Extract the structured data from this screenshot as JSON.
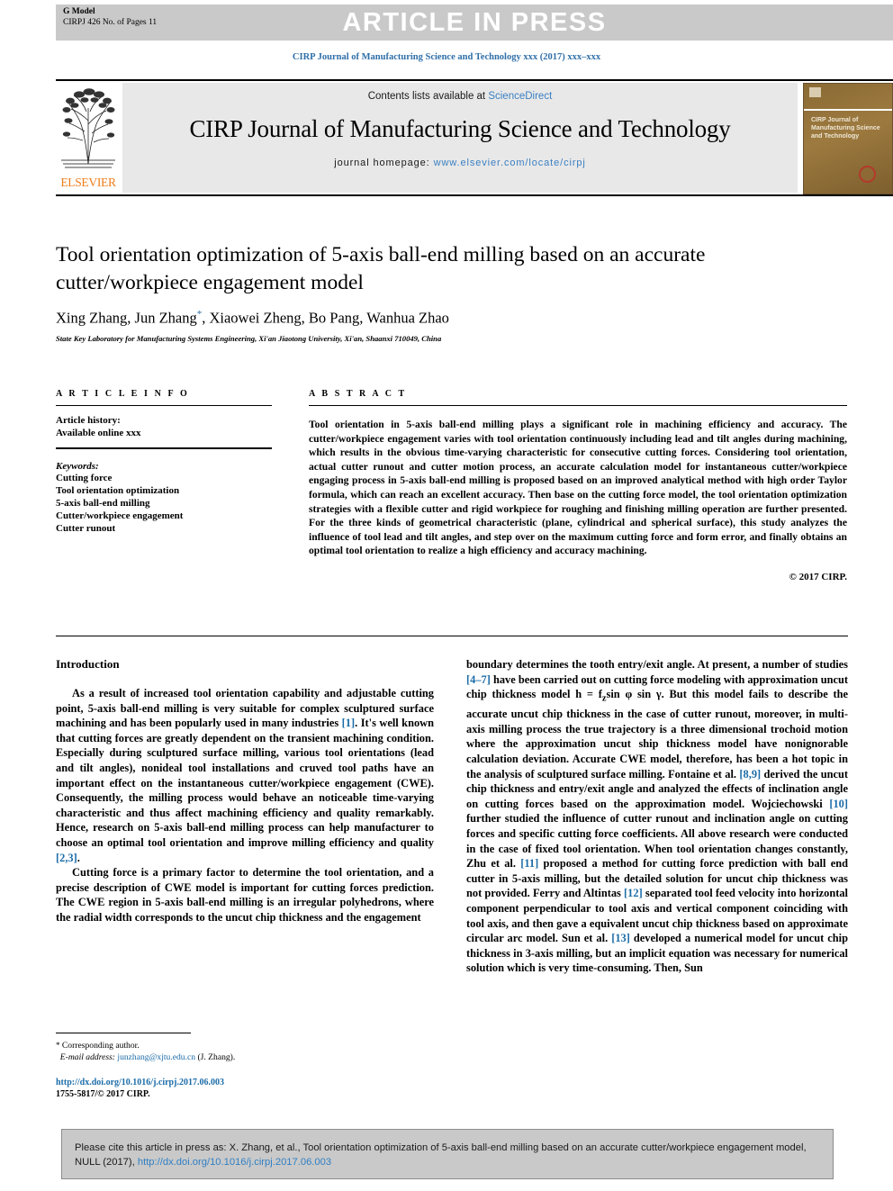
{
  "banner": {
    "gmodel_label": "G Model",
    "gmodel_sub": "CIRPJ 426 No. of Pages 11",
    "article_in_press": "ARTICLE IN PRESS"
  },
  "journal_ref": "CIRP Journal of Manufacturing Science and Technology xxx (2017) xxx–xxx",
  "masthead": {
    "publisher": "ELSEVIER",
    "contents_prefix": "Contents lists available at ",
    "contents_link": "ScienceDirect",
    "journal_title": "CIRP Journal of Manufacturing Science and Technology",
    "homepage_label": "journal homepage: ",
    "homepage_url": "www.elsevier.com/locate/cirpj",
    "cover_title": "CIRP Journal of Manufacturing Science and Technology"
  },
  "article": {
    "title": "Tool orientation optimization of 5-axis ball-end milling based on an accurate cutter/workpiece engagement model",
    "authors": "Xing Zhang, Jun Zhang",
    "authors_marker": "*",
    "authors_rest": ", Xiaowei Zheng, Bo Pang, Wanhua Zhao",
    "affiliation": "State Key Laboratory for Manufacturing Systems Engineering, Xi'an Jiaotong University, Xi'an, Shaanxi 710049, China"
  },
  "info": {
    "heading": "A R T I C L E   I N F O",
    "history_label": "Article history:",
    "history_value": "Available online xxx",
    "keywords_label": "Keywords:",
    "keywords": [
      "Cutting force",
      "Tool orientation optimization",
      "5-axis ball-end milling",
      "Cutter/workpiece engagement",
      "Cutter runout"
    ]
  },
  "abstract": {
    "heading": "A B S T R A C T",
    "text": "Tool orientation in 5-axis ball-end milling plays a significant role in machining efficiency and accuracy. The cutter/workpiece engagement varies with tool orientation continuously including lead and tilt angles during machining, which results in the obvious time-varying characteristic for consecutive cutting forces. Considering tool orientation, actual cutter runout and cutter motion process, an accurate calculation model for instantaneous cutter/workpiece engaging process in 5-axis ball-end milling is proposed based on an improved analytical method with high order Taylor formula, which can reach an excellent accuracy. Then base on the cutting force model, the tool orientation optimization strategies with a flexible cutter and rigid workpiece for roughing and finishing milling operation are further presented. For the three kinds of geometrical characteristic (plane, cylindrical and spherical surface), this study analyzes the influence of tool lead and tilt angles, and step over on the maximum cutting force and form error, and finally obtains an optimal tool orientation to realize a high efficiency and accuracy machining.",
    "copyright": "© 2017 CIRP."
  },
  "body": {
    "section_heading": "Introduction",
    "left_paragraph_1_a": "As a result of increased tool orientation capability and adjustable cutting point, 5-axis ball-end milling is very suitable for complex sculptured surface machining and has been popularly used in many industries ",
    "left_ref_1": "[1]",
    "left_paragraph_1_b": ". It's well known that cutting forces are greatly dependent on the transient machining condition. Especially during sculptured surface milling, various tool orientations (lead and tilt angles), nonideal tool installations and cruved tool paths have an important effect on the instantaneous cutter/workpiece engagement (CWE). Consequently, the milling process would behave an noticeable time-varying characteristic and thus affect machining efficiency and quality remarkably. Hence, research on 5-axis ball-end milling process can help manufacturer to choose an optimal tool orientation and improve milling efficiency and quality ",
    "left_ref_2": "[2,3]",
    "left_paragraph_1_c": ".",
    "left_paragraph_2": "Cutting force is a primary factor to determine the tool orientation, and a precise description of CWE model is important for cutting forces prediction. The CWE region in 5-axis ball-end milling is an irregular polyhedrons, where the radial width corresponds to the uncut chip thickness and the engagement",
    "right_a": "boundary determines the tooth entry/exit angle. At present, a number of studies ",
    "right_ref_47": "[4–7]",
    "right_b": " have been carried out on cutting force modeling with approximation uncut chip thickness model h = f",
    "right_b_sub": "z",
    "right_b2": "sin ",
    "right_phi": "φ",
    "right_b3": " sin ",
    "right_gamma": "γ",
    "right_c": ". But this model fails to describe the accurate uncut chip thickness in the case of cutter runout, moreover, in multi-axis milling process the true trajectory is a three dimensional trochoid motion where the approximation uncut ship thickness model have nonignorable calculation deviation. Accurate CWE model, therefore, has been a hot topic in the analysis of sculptured surface milling. Fontaine et al. ",
    "right_ref_89": "[8,9]",
    "right_d": " derived the uncut chip thickness and entry/exit angle and analyzed the effects of inclination angle on cutting forces based on the approximation model. Wojciechowski ",
    "right_ref_10": "[10]",
    "right_e": " further studied the influence of cutter runout and inclination angle on cutting forces and specific cutting force coefficients. All above research were conducted in the case of fixed tool orientation. When tool orientation changes constantly, Zhu et al. ",
    "right_ref_11": "[11]",
    "right_f": " proposed a method for cutting force prediction with ball end cutter in 5-axis milling, but the detailed solution for uncut chip thickness was not provided. Ferry and Altintas ",
    "right_ref_12": "[12]",
    "right_g": " separated tool feed velocity into horizontal component perpendicular to tool axis and vertical component coinciding with tool axis, and then gave a equivalent uncut chip thickness based on approximate circular arc model. Sun et al. ",
    "right_ref_13": "[13]",
    "right_h": " developed a numerical model for uncut chip thickness in 3-axis milling, but an implicit equation was necessary for numerical solution which is very time-consuming. Then, Sun"
  },
  "footnote": {
    "corresponding": "Corresponding author.",
    "email_label": "E-mail address:",
    "email": "junzhang@xjtu.edu.cn",
    "email_owner": "(J. Zhang).",
    "doi": "http://dx.doi.org/10.1016/j.cirpj.2017.06.003",
    "issn": "1755-5817/© 2017 CIRP."
  },
  "cite_box": {
    "text_a": "Please cite this article in press as: X. Zhang, et al., Tool orientation optimization of 5-axis ball-end milling based on an accurate cutter/workpiece engagement model, NULL (2017), ",
    "link": "http://dx.doi.org/10.1016/j.cirpj.2017.06.003"
  },
  "colors": {
    "link_blue": "#3a7fc1",
    "ref_blue": "#1b6ca8",
    "elsevier_orange": "#ef7d1a",
    "banner_grey": "#c9c9c9"
  }
}
